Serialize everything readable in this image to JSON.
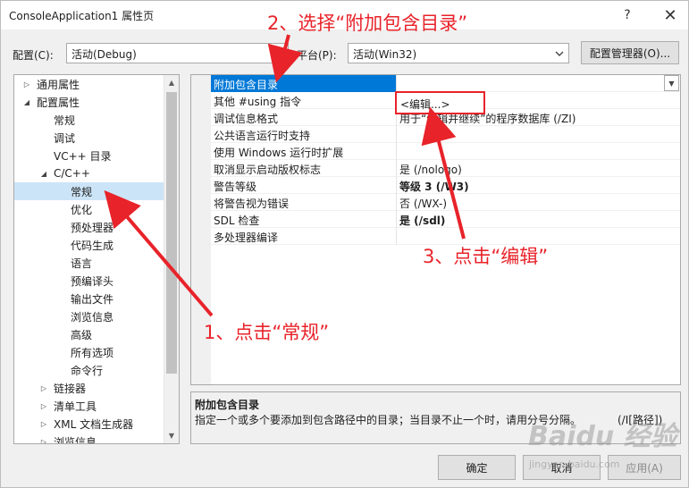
{
  "window": {
    "title": "ConsoleApplication1 属性页",
    "help_glyph": "?",
    "close_glyph": "✕"
  },
  "config": {
    "config_label": "配置(C):",
    "config_value": "活动(Debug)",
    "platform_label": "平台(P):",
    "platform_value": "活动(Win32)",
    "manager_button": "配置管理器(O)..."
  },
  "tree": {
    "items": [
      {
        "label": "通用属性",
        "twisty": "▷"
      },
      {
        "label": "配置属性",
        "twisty": "◢"
      },
      {
        "label": "常规",
        "twisty": ""
      },
      {
        "label": "调试",
        "twisty": ""
      },
      {
        "label": "VC++ 目录",
        "twisty": ""
      },
      {
        "label": "C/C++",
        "twisty": "◢"
      },
      {
        "label": "常规",
        "twisty": ""
      },
      {
        "label": "优化",
        "twisty": ""
      },
      {
        "label": "预处理器",
        "twisty": ""
      },
      {
        "label": "代码生成",
        "twisty": ""
      },
      {
        "label": "语言",
        "twisty": ""
      },
      {
        "label": "预编译头",
        "twisty": ""
      },
      {
        "label": "输出文件",
        "twisty": ""
      },
      {
        "label": "浏览信息",
        "twisty": ""
      },
      {
        "label": "高级",
        "twisty": ""
      },
      {
        "label": "所有选项",
        "twisty": ""
      },
      {
        "label": "命令行",
        "twisty": ""
      },
      {
        "label": "链接器",
        "twisty": "▷"
      },
      {
        "label": "清单工具",
        "twisty": "▷"
      },
      {
        "label": "XML 文档生成器",
        "twisty": "▷"
      },
      {
        "label": "浏览信息",
        "twisty": "▷"
      }
    ]
  },
  "grid": {
    "rows": [
      {
        "name": "附加包含目录",
        "value": ""
      },
      {
        "name": "其他 #using 指令",
        "value": ""
      },
      {
        "name": "调试信息格式",
        "value": "用于“编辑并继续”的程序数据库 (/ZI)"
      },
      {
        "name": "公共语言运行时支持",
        "value": ""
      },
      {
        "name": "使用 Windows 运行时扩展",
        "value": ""
      },
      {
        "name": "取消显示启动版权标志",
        "value": "是 (/nologo)"
      },
      {
        "name": "警告等级",
        "value": "等级 3 (/W3)"
      },
      {
        "name": "将警告视为错误",
        "value": "否 (/WX-)"
      },
      {
        "name": "SDL 检查",
        "value": "是 (/sdl)"
      },
      {
        "name": "多处理器编译",
        "value": ""
      }
    ],
    "edit_popup": "<编辑...>"
  },
  "description": {
    "title": "附加包含目录",
    "text": "指定一个或多个要添加到包含路径中的目录；当目录不止一个时，请用分号分隔。",
    "switch": "(/I[路径])"
  },
  "buttons": {
    "ok": "确定",
    "cancel": "取消",
    "apply": "应用(A)"
  },
  "annotations": {
    "step1": "1、点击“常规”",
    "step2": "2、选择“附加包含目录”",
    "step3": "3、点击“编辑”",
    "color": "#e8232a"
  },
  "watermark": {
    "brand": "Baidu 经验",
    "url": "jingyan.baidu.com"
  }
}
